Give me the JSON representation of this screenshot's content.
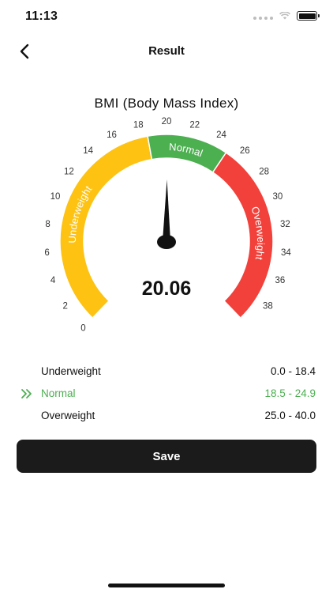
{
  "status_bar": {
    "time": "11:13"
  },
  "nav": {
    "title": "Result"
  },
  "gauge": {
    "title": "BMI (Body Mass Index)",
    "value": "20.06",
    "bmi": 20.06,
    "scale_min": 0,
    "scale_max": 40,
    "ticks": [
      "0",
      "2",
      "4",
      "6",
      "8",
      "10",
      "12",
      "14",
      "16",
      "18",
      "20",
      "22",
      "24",
      "26",
      "28",
      "30",
      "32",
      "34",
      "36",
      "38"
    ],
    "segments": [
      {
        "label": "Underweight",
        "from": 0,
        "to": 18.5,
        "color": "#fdc212"
      },
      {
        "label": "Normal",
        "from": 18.5,
        "to": 25,
        "color": "#4caf50"
      },
      {
        "label": "Overweight",
        "from": 25,
        "to": 40,
        "color": "#f2413b"
      }
    ]
  },
  "ranges": [
    {
      "label": "Underweight",
      "value": "0.0 - 18.4",
      "active": false
    },
    {
      "label": "Normal",
      "value": "18.5 - 24.9",
      "active": true
    },
    {
      "label": "Overweight",
      "value": "25.0 - 40.0",
      "active": false
    }
  ],
  "colors": {
    "accent_green": "#4caf50",
    "button_bg": "#1b1b1b"
  },
  "actions": {
    "save_label": "Save"
  }
}
